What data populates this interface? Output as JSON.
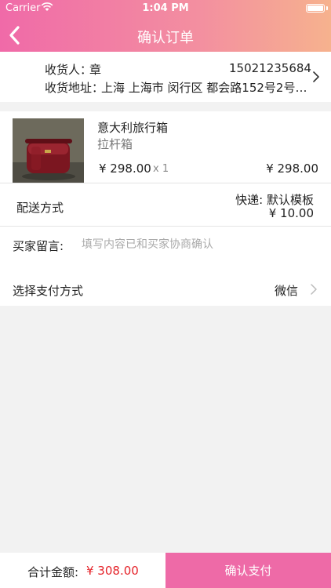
{
  "status_bar": {
    "carrier": "Carrier",
    "time": "1:04 PM"
  },
  "nav": {
    "title": "确认订单"
  },
  "address": {
    "name_label": "收货人：",
    "name": "章",
    "phone": "15021235684",
    "address_label": "收货地址：",
    "address": "上海 上海市 闵行区 都会路152号2号…"
  },
  "goods": {
    "name": "意大利旅行箱",
    "subtitle": "拉杆箱",
    "price": "¥ 298.00",
    "quantity": "x 1",
    "subtotal": "¥ 298.00"
  },
  "shipping": {
    "label": "配送方式",
    "method": "快递: 默认模板",
    "fee": "¥ 10.00"
  },
  "message": {
    "label": "买家留言:",
    "value": "",
    "placeholder": "填写内容已和买家协商确认"
  },
  "payment": {
    "label": "选择支付方式",
    "value": "微信"
  },
  "footer": {
    "total_label": "合计金额:",
    "total_value": "¥ 308.00",
    "confirm_label": "确认支付"
  },
  "colors": {
    "accent": "#ee6aa7",
    "header_gradient_start": "#f06aa8",
    "header_gradient_end": "#f6b28e",
    "price_red": "#e5242b"
  },
  "icons": {
    "back": "chevron-left-icon",
    "address_more": "chevron-right-icon",
    "payment_more": "chevron-right-icon"
  }
}
